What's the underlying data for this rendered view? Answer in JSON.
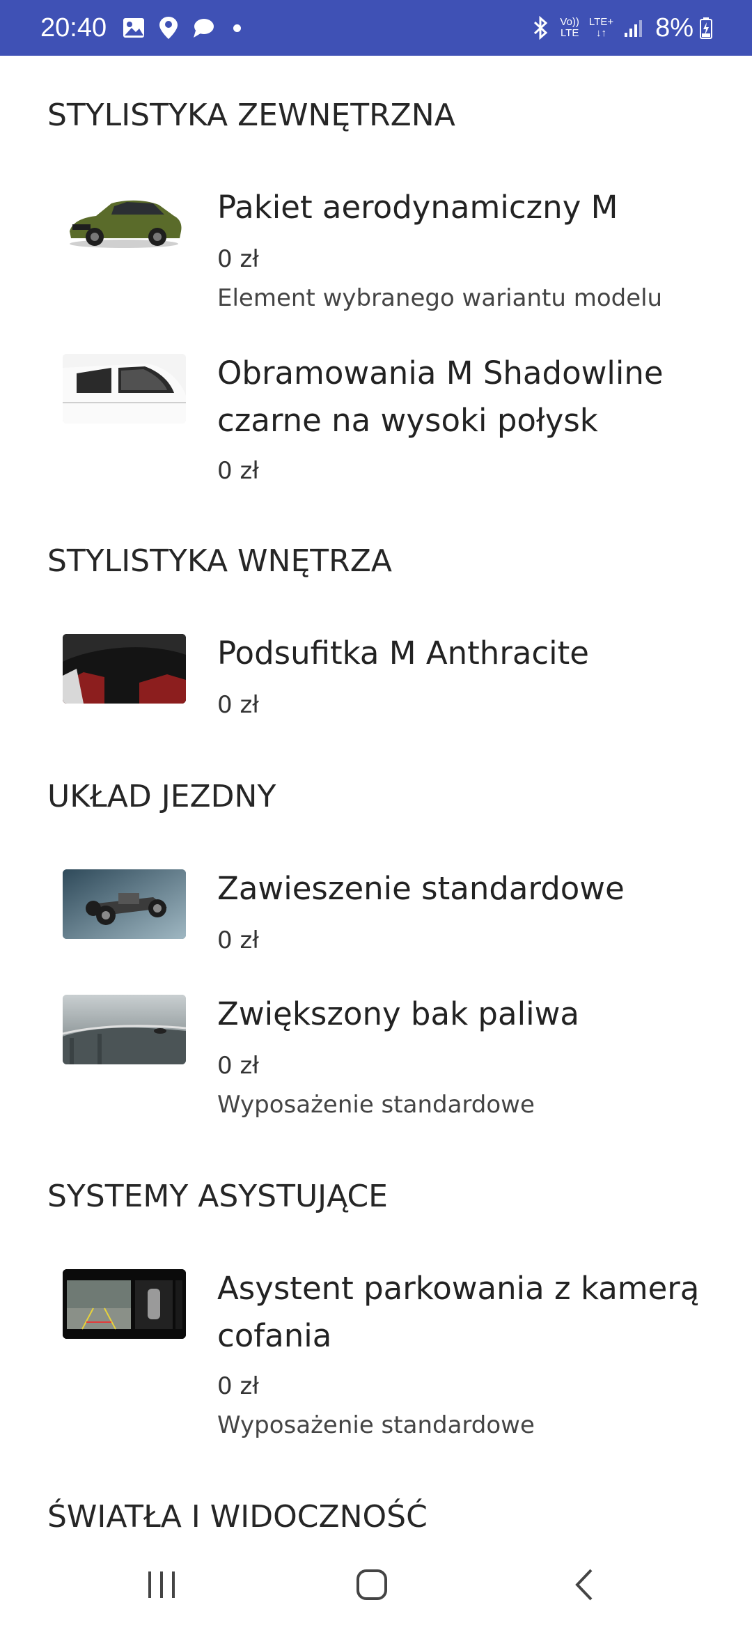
{
  "status_bar": {
    "time": "20:40",
    "network_top": "Vo))",
    "network_bottom": "LTE",
    "lte_plus": "LTE+",
    "battery": "8%"
  },
  "sections": [
    {
      "title": "STYLISTYKA ZEWNĘTRZNA",
      "items": [
        {
          "title": "Pakiet aerodynamiczny M",
          "price": "0 zł",
          "note": "Element wybranego wariantu modelu",
          "image": "green-suv"
        },
        {
          "title": "Obramowania M Shadowline czarne na wysoki połysk",
          "price": "0 zł",
          "note": "",
          "image": "white-car-side-windows"
        }
      ]
    },
    {
      "title": "STYLISTYKA WNĘTRZA",
      "items": [
        {
          "title": "Podsufitka M Anthracite",
          "price": "0 zł",
          "note": "",
          "image": "dark-headliner"
        }
      ]
    },
    {
      "title": "UKŁAD JEZDNY",
      "items": [
        {
          "title": "Zawieszenie standardowe",
          "price": "0 zł",
          "note": "",
          "image": "chassis"
        },
        {
          "title": "Zwiększony bak paliwa",
          "price": "0 zł",
          "note": "Wyposażenie standardowe",
          "image": "bridge-road"
        }
      ]
    },
    {
      "title": "SYSTEMY ASYSTUJĄCE",
      "items": [
        {
          "title": "Asystent parkowania z kamerą cofania",
          "price": "0 zł",
          "note": "Wyposażenie standardowe",
          "image": "parking-camera-screen"
        }
      ]
    },
    {
      "title": "ŚWIATŁA I WIDOCZNOŚĆ",
      "items": []
    }
  ],
  "colors": {
    "status_bar": "#3f51b5",
    "background": "#ffffff",
    "text": "#262626"
  }
}
